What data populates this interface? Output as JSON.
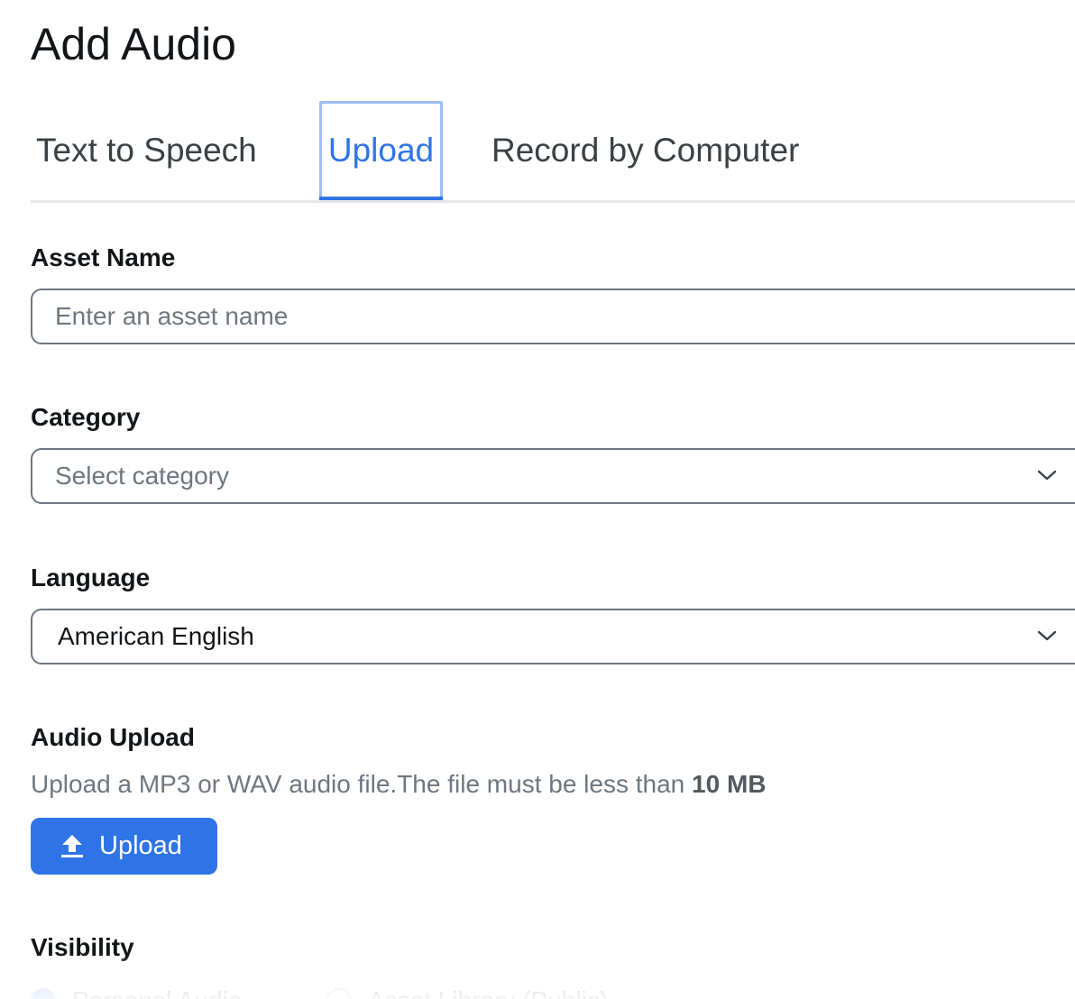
{
  "title": "Add Audio",
  "tabs": [
    {
      "label": "Text to Speech",
      "active": false
    },
    {
      "label": "Upload",
      "active": true
    },
    {
      "label": "Record by Computer",
      "active": false
    }
  ],
  "asset_name": {
    "label": "Asset Name",
    "placeholder": "Enter an asset name",
    "value": ""
  },
  "category": {
    "label": "Category",
    "placeholder": "Select category"
  },
  "language": {
    "label": "Language",
    "value": "American English"
  },
  "audio_upload": {
    "label": "Audio Upload",
    "help_text": "Upload a MP3 or WAV audio file.The file must be less than ",
    "help_limit": "10 MB",
    "button_label": "Upload",
    "button_icon": "upload-arrow-icon"
  },
  "visibility": {
    "label": "Visibility",
    "options": [
      {
        "label": "Personal Audio",
        "checked": true
      },
      {
        "label": "Asset Library (Public)",
        "checked": false
      }
    ]
  },
  "colors": {
    "accent": "#2f74e6",
    "text": "#131619",
    "muted": "#6e7680",
    "border": "#6e7680"
  }
}
